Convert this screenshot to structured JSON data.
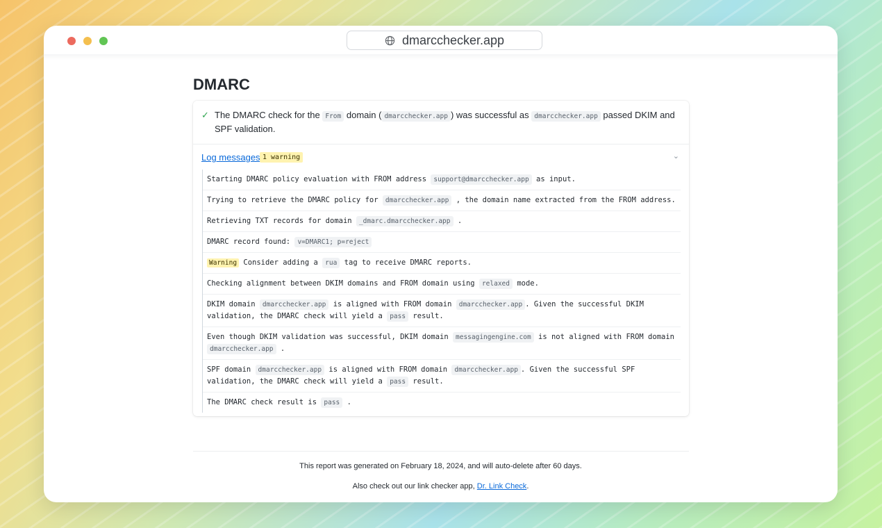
{
  "browser": {
    "url": "dmarcchecker.app"
  },
  "section": {
    "title": "DMARC"
  },
  "summary": {
    "pre": "The DMARC check for the",
    "code1": "From",
    "mid1": "domain (",
    "code2": "dmarcchecker.app",
    "mid2": ") was successful as",
    "code3": "dmarcchecker.app",
    "post": "passed DKIM and SPF validation."
  },
  "log": {
    "link_label": "Log messages",
    "badge": "1 warning",
    "warning_label": "Warning",
    "items": [
      {
        "t1": "Starting DMARC policy evaluation with FROM address",
        "c1": "support@dmarcchecker.app",
        "t2": "as input."
      },
      {
        "t1": "Trying to retrieve the DMARC policy for",
        "c1": "dmarcchecker.app",
        "t2": ", the domain name extracted from the FROM address."
      },
      {
        "t1": "Retrieving TXT records for domain",
        "c1": "_dmarc.dmarcchecker.app",
        "t2": "."
      },
      {
        "t1": "DMARC record found:",
        "c1": "v=DMARC1; p=reject"
      },
      {
        "t1": "Consider adding a",
        "c1": "rua",
        "t2": "tag to receive DMARC reports."
      },
      {
        "t1": "Checking alignment between DKIM domains and FROM domain using",
        "c1": "relaxed",
        "t2": "mode."
      },
      {
        "t1": "DKIM domain",
        "c1": "dmarcchecker.app",
        "t2": "is aligned with FROM domain",
        "c2": "dmarcchecker.app",
        "t3": ". Given the successful DKIM validation, the DMARC check will yield a",
        "c3": "pass",
        "t4": "result."
      },
      {
        "t1": "Even though DKIM validation was successful, DKIM domain",
        "c1": "messagingengine.com",
        "t2": "is not aligned with FROM domain",
        "c2": "dmarcchecker.app",
        "t3": "."
      },
      {
        "t1": "SPF domain",
        "c1": "dmarcchecker.app",
        "t2": "is aligned with FROM domain",
        "c2": "dmarcchecker.app",
        "t3": ". Given the successful SPF validation, the DMARC check will yield a",
        "c3": "pass",
        "t4": "result."
      },
      {
        "t1": "The DMARC check result is",
        "c1": "pass",
        "t2": "."
      }
    ]
  },
  "footer": {
    "line1": "This report was generated on February 18, 2024, and will auto-delete after 60 days.",
    "line2_pre": "Also check out our link checker app,",
    "line2_link": "Dr. Link Check",
    "line2_post": "."
  },
  "colors": {
    "accent": "#0969da",
    "success": "#2da44e",
    "warning_bg": "#fff3b0"
  }
}
